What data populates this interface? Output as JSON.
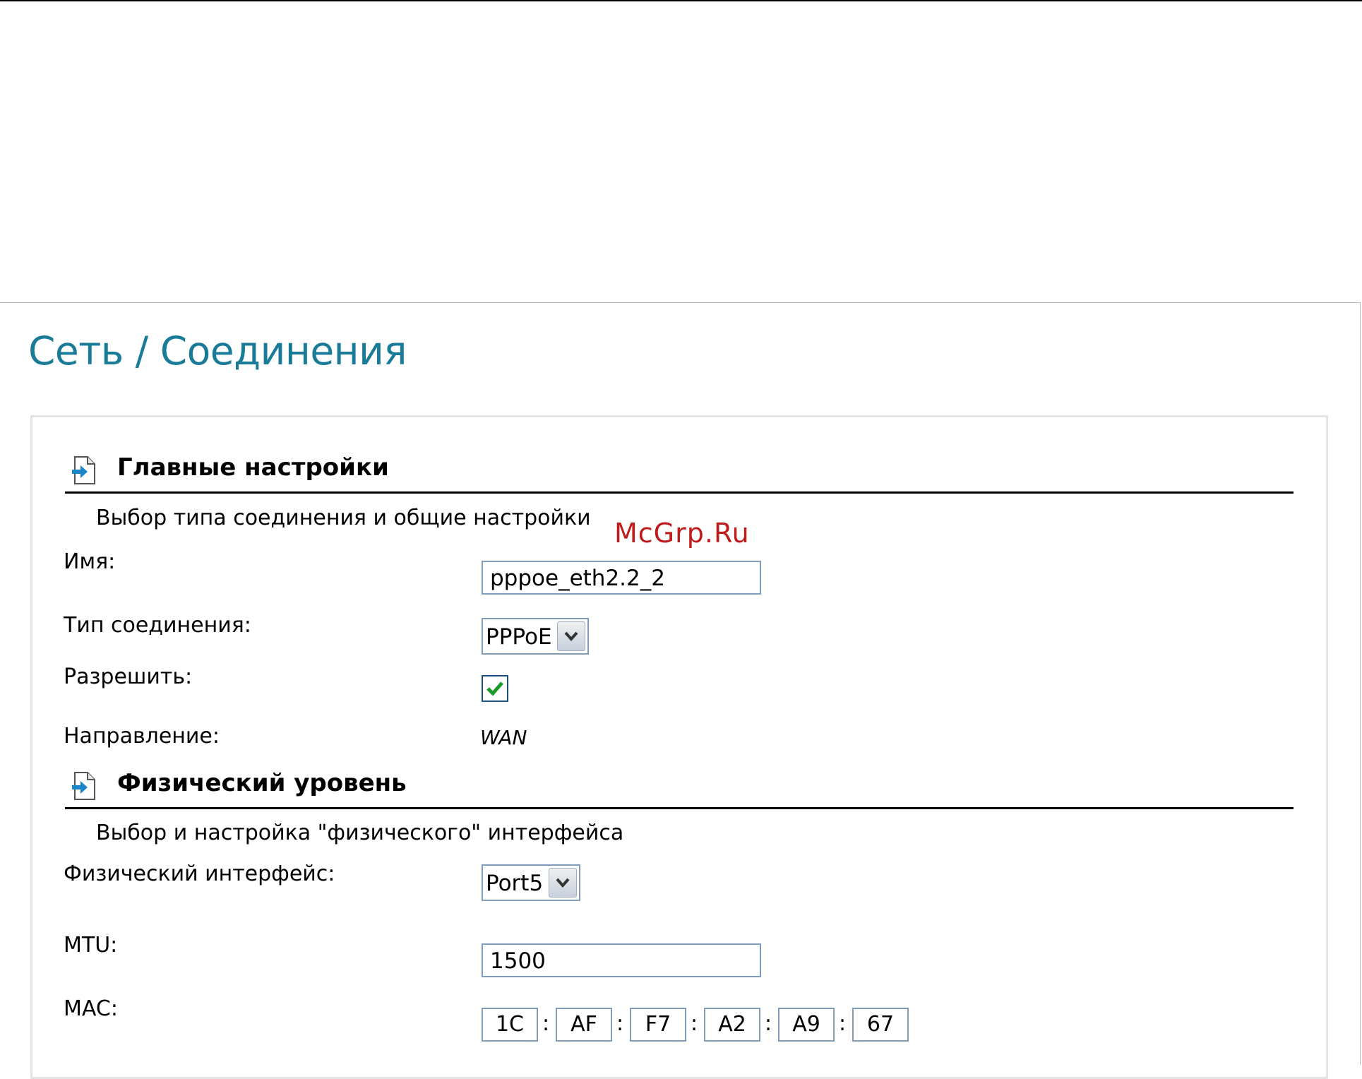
{
  "page": {
    "title": "Сеть / Соединения",
    "watermark": "McGrp.Ru"
  },
  "sections": [
    {
      "icon": "document-arrow-icon",
      "title": "Главные настройки",
      "description": "Выбор типа соединения и общие настройки"
    },
    {
      "icon": "document-arrow-icon",
      "title": "Физический уровень",
      "description": "Выбор и настройка \"физического\" интерфейса"
    }
  ],
  "main_settings": {
    "name_label": "Имя:",
    "name_value": "pppoe_eth2.2_2",
    "conn_type_label": "Тип соединения:",
    "conn_type_value": "PPPoE",
    "enable_label": "Разрешить:",
    "enable_checked": true,
    "direction_label": "Направление:",
    "direction_value": "WAN"
  },
  "physical": {
    "iface_label": "Физический интерфейс:",
    "iface_value": "Port5",
    "mtu_label": "MTU:",
    "mtu_value": "1500",
    "mac_label": "MAC:",
    "mac_octets": [
      "1C",
      "AF",
      "F7",
      "A2",
      "A9",
      "67"
    ],
    "mac_separator": ":"
  },
  "colors": {
    "title": "#1a7b99",
    "input_border": "#7f9db9",
    "check_mark": "#1a9a2a",
    "watermark": "#c01a1a"
  }
}
